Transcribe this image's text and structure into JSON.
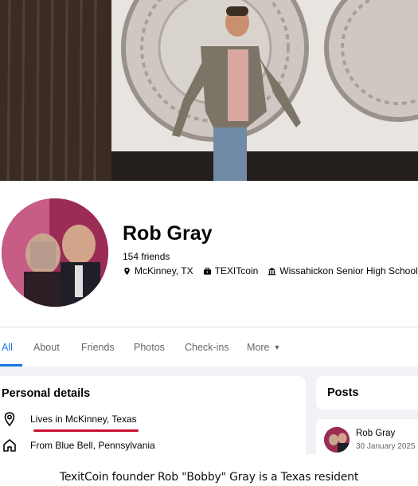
{
  "profile": {
    "name": "Rob Gray",
    "friends": "154 friends",
    "location": "McKinney, TX",
    "work": "TEXITcoin",
    "school": "Wissahickon Senior High School"
  },
  "tabs": [
    {
      "label": "All",
      "active": true
    },
    {
      "label": "About"
    },
    {
      "label": "Friends"
    },
    {
      "label": "Photos"
    },
    {
      "label": "Check-ins"
    },
    {
      "label": "More"
    }
  ],
  "personal_details": {
    "title": "Personal details",
    "rows": [
      {
        "icon": "location-pin-icon",
        "text": "Lives in McKinney, Texas"
      },
      {
        "icon": "home-icon",
        "text": "From Blue Bell, Pennsylvania"
      }
    ]
  },
  "posts": {
    "title": "Posts",
    "author": "Rob Gray",
    "date": "30 January 2025"
  },
  "caption": "TexitCoin founder Rob \"Bobby\" Gray is a Texas resident",
  "colors": {
    "accent": "#1b74e4",
    "highlight_underline": "#c8102e",
    "background": "#f0f2f5"
  }
}
